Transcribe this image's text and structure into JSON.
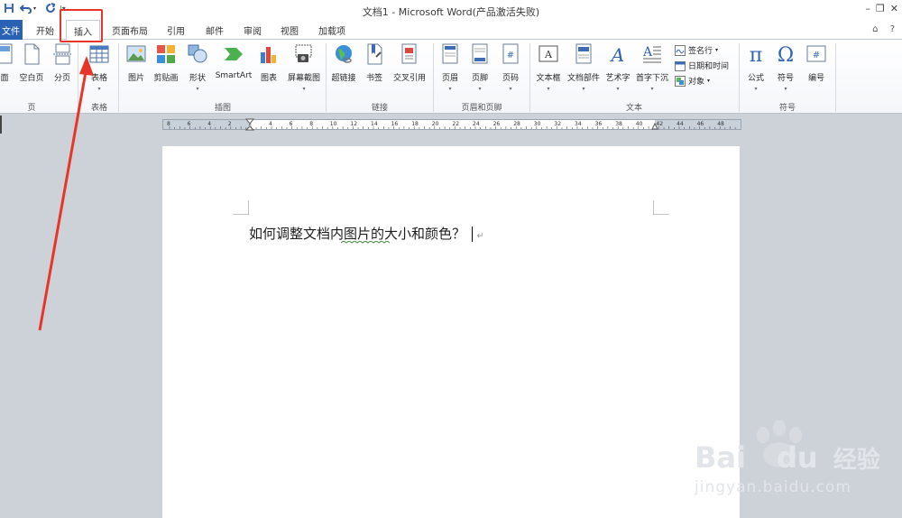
{
  "window": {
    "title": "文档1  -  Microsoft Word(产品激活失败)",
    "controls": [
      "–",
      "❐",
      "✕"
    ]
  },
  "tabs": {
    "file": "文件",
    "items": [
      "开始",
      "插入",
      "页面布局",
      "引用",
      "邮件",
      "审阅",
      "视图",
      "加载项"
    ],
    "active": "插入",
    "right_icons": [
      "⌂",
      "?"
    ]
  },
  "ribbon": {
    "pages": {
      "cover_page": "面",
      "blank_page": "空白页",
      "page_break": "分页",
      "label": "页"
    },
    "tables": {
      "table": "表格",
      "label": "表格"
    },
    "illustrations": {
      "picture": "图片",
      "clip_art": "剪贴画",
      "shapes": "形状",
      "smartart": "SmartArt",
      "chart": "图表",
      "screenshot": "屏幕截图",
      "label": "插图"
    },
    "links": {
      "hyperlink": "超链接",
      "bookmark": "书签",
      "cross_reference": "交叉引用",
      "label": "链接"
    },
    "header_footer": {
      "header": "页眉",
      "footer": "页脚",
      "page_number": "页码",
      "label": "页眉和页脚"
    },
    "text": {
      "text_box": "文本框",
      "quick_parts": "文档部件",
      "wordart": "艺术字",
      "drop_cap": "首字下沉",
      "signature_line": "签名行",
      "date_time": "日期和时间",
      "object": "对象",
      "label": "文本"
    },
    "symbols": {
      "equation": "公式",
      "symbol": "符号",
      "number": "编号",
      "label": "符号"
    }
  },
  "ruler": {
    "numbers": [
      "8",
      "6",
      "4",
      "2",
      "2",
      "4",
      "6",
      "8",
      "10",
      "12",
      "14",
      "16",
      "18",
      "20",
      "22",
      "24",
      "26",
      "28",
      "30",
      "32",
      "34",
      "36",
      "38",
      "40",
      "42",
      "44",
      "46",
      "48"
    ]
  },
  "document": {
    "text": "如何调整文档内图片的大小和颜色？"
  },
  "watermark": {
    "brand": "Bai",
    "brand_du": "du",
    "brand_cn": "经验",
    "url": "jingyan.baidu.com"
  },
  "colors": {
    "file_tab": "#2a61b5",
    "annotation": "#e8352a",
    "background": "#cdd2d8"
  }
}
